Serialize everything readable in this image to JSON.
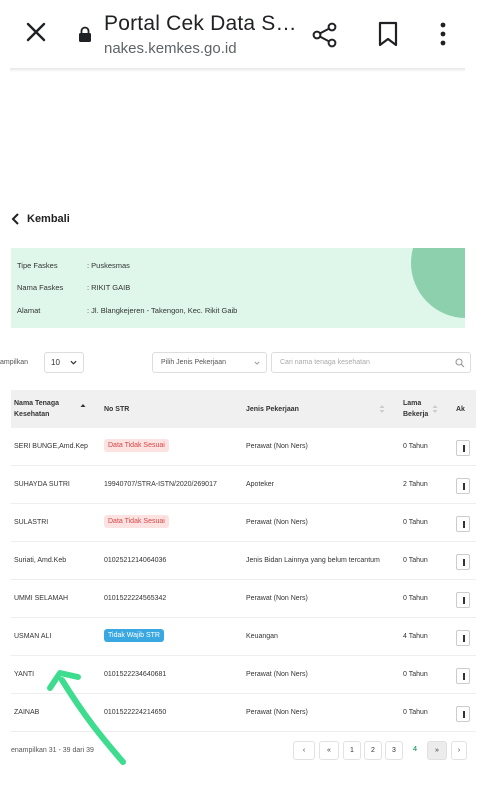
{
  "browser": {
    "title": "Portal Cek Data S…",
    "url": "nakes.kemkes.go.id"
  },
  "back_label": "Kembali",
  "info": {
    "rows": [
      {
        "key": "Tipe Faskes",
        "value": ": Puskesmas"
      },
      {
        "key": "Nama Faskes",
        "value": ": RIKIT GAIB"
      },
      {
        "key": "Alamat",
        "value": ": Jl. Blangkejeren - Takengon, Kec. Rikit Gaib"
      }
    ]
  },
  "filters": {
    "show_label": "ampilkan",
    "show_value": "10",
    "job_placeholder": "Pilih Jenis Pekerjaan",
    "search_placeholder": "Cari nama tenaga kesehatan"
  },
  "table": {
    "headers": {
      "name_line1": "Nama Tenaga",
      "name_line2": "Kesehatan",
      "str": "No STR",
      "job": "Jenis Pekerjaan",
      "duration_line1": "Lama",
      "duration_line2": "Bekerja",
      "action": "Ak"
    },
    "rows": [
      {
        "name": "SERI BUNGE,Amd.Kep",
        "str": "Data Tidak Sesuai",
        "str_badge": "red",
        "job": "Perawat (Non Ners)",
        "duration": "0 Tahun"
      },
      {
        "name": "SUHAYDA SUTRI",
        "str": "19940707/STRA-ISTN/2020/269017",
        "str_badge": "",
        "job": "Apoteker",
        "duration": "2 Tahun"
      },
      {
        "name": "SULASTRI",
        "str": "Data Tidak Sesuai",
        "str_badge": "red",
        "job": "Perawat (Non Ners)",
        "duration": "0 Tahun"
      },
      {
        "name": "Suriati, Amd.Keb",
        "str": "0102521214064036",
        "str_badge": "",
        "job": "Jenis Bidan Lainnya yang belum tercantum",
        "duration": "0 Tahun"
      },
      {
        "name": "UMMI SELAMAH",
        "str": "0101522224565342",
        "str_badge": "",
        "job": "Perawat (Non Ners)",
        "duration": "0 Tahun"
      },
      {
        "name": "USMAN ALI",
        "str": "Tidak Wajib STR",
        "str_badge": "blue",
        "job": "Keuangan",
        "duration": "4 Tahun"
      },
      {
        "name": "YANTI",
        "str": "0101522234640681",
        "str_badge": "",
        "job": "Perawat (Non Ners)",
        "duration": "0 Tahun"
      },
      {
        "name": "ZAINAB",
        "str": "0101522224214650",
        "str_badge": "",
        "job": "Perawat (Non Ners)",
        "duration": "0 Tahun"
      }
    ]
  },
  "footer": {
    "summary": "enampilkan 31 - 39 dari 39"
  },
  "pagination": {
    "items": [
      "‹",
      "«",
      "1",
      "2",
      "3",
      "4",
      "»",
      "›"
    ],
    "active": "4"
  },
  "colors": {
    "info_bg": "#def7ea",
    "info_circle": "#7ec9a3",
    "badge_red_bg": "#fde2e2",
    "badge_red_text": "#d64545",
    "badge_blue": "#3aa8e0",
    "active_page": "#2eaa6e",
    "arrow": "#3ddc8e"
  }
}
